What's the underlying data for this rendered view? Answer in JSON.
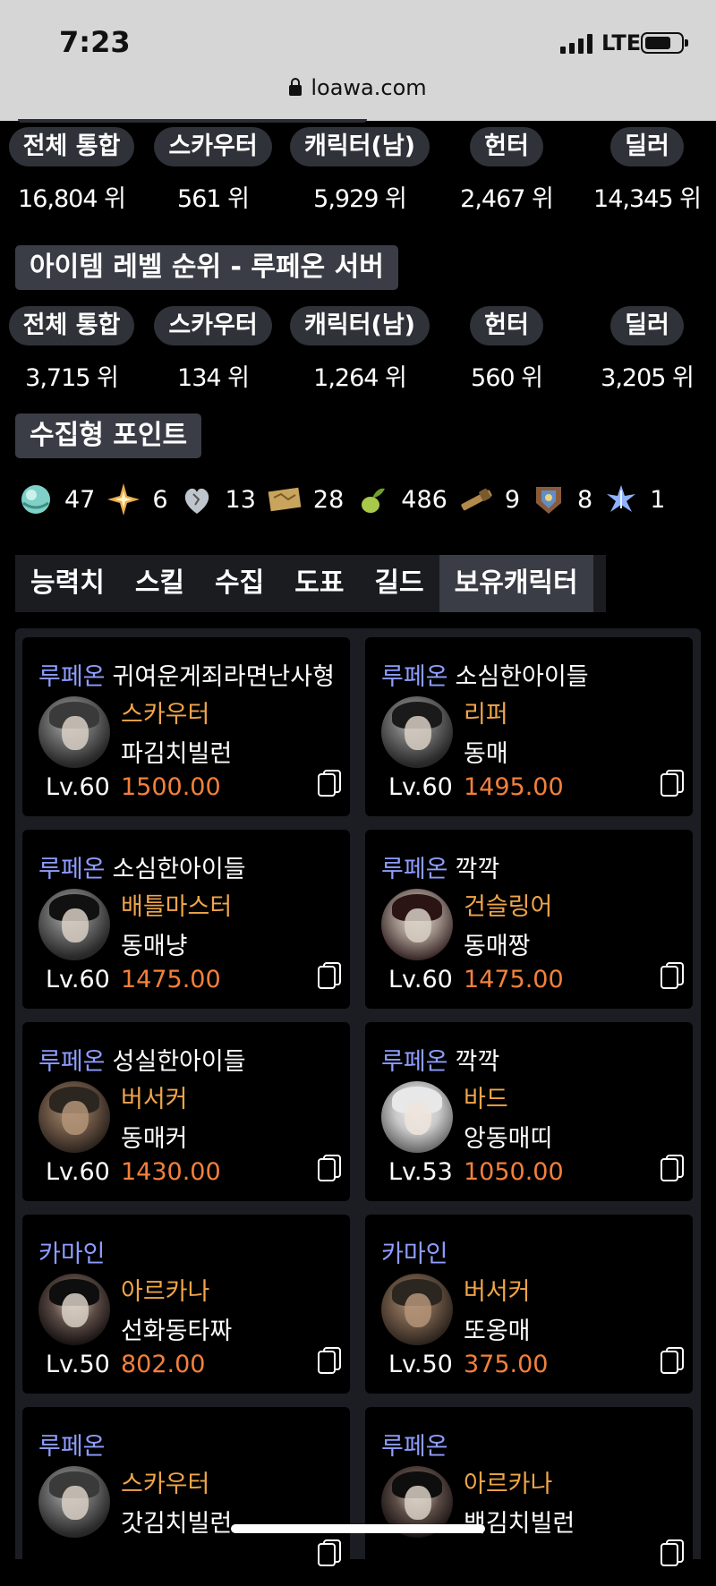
{
  "status_bar": {
    "time": "7:23",
    "network": "LTE"
  },
  "browser": {
    "url": "loawa.com"
  },
  "rankings": [
    {
      "cols": [
        {
          "label": "전체 통합",
          "value": "16,804 위"
        },
        {
          "label": "스카우터",
          "value": "561 위"
        },
        {
          "label": "캐릭터(남)",
          "value": "5,929 위"
        },
        {
          "label": "헌터",
          "value": "2,467 위"
        },
        {
          "label": "딜러",
          "value": "14,345 위"
        }
      ]
    },
    {
      "title": "아이템 레벨 순위 - 루페온 서버",
      "cols": [
        {
          "label": "전체 통합",
          "value": "3,715 위"
        },
        {
          "label": "스카우터",
          "value": "134 위"
        },
        {
          "label": "캐릭터(남)",
          "value": "1,264 위"
        },
        {
          "label": "헌터",
          "value": "560 위"
        },
        {
          "label": "딜러",
          "value": "3,205 위"
        }
      ]
    }
  ],
  "collection": {
    "title": "수집형 포인트",
    "items": [
      {
        "icon": "island-heart-icon",
        "count": "47"
      },
      {
        "icon": "star-seed-icon",
        "count": "6"
      },
      {
        "icon": "giant-heart-icon",
        "count": "13"
      },
      {
        "icon": "art-map-icon",
        "count": "28"
      },
      {
        "icon": "mokoko-seed-icon",
        "count": "486"
      },
      {
        "icon": "voyage-telescope-icon",
        "count": "9"
      },
      {
        "icon": "ignea-token-icon",
        "count": "8"
      },
      {
        "icon": "world-tree-leaf-icon",
        "count": "1"
      }
    ]
  },
  "tabs": [
    "능력치",
    "스킬",
    "수집",
    "도표",
    "길드",
    "보유캐릭터"
  ],
  "active_tab": "보유캐릭터",
  "characters": [
    {
      "server": "루페온",
      "guild": "귀여운게죄라면난사형",
      "class": "스카우터",
      "name": "파김치빌런",
      "level": "Lv.60",
      "item_level": "1500.00"
    },
    {
      "server": "루페온",
      "guild": "소심한아이들",
      "class": "리퍼",
      "name": "동매",
      "level": "Lv.60",
      "item_level": "1495.00"
    },
    {
      "server": "루페온",
      "guild": "소심한아이들",
      "class": "배틀마스터",
      "name": "동매냥",
      "level": "Lv.60",
      "item_level": "1475.00"
    },
    {
      "server": "루페온",
      "guild": "깍깍",
      "class": "건슬링어",
      "name": "동매짱",
      "level": "Lv.60",
      "item_level": "1475.00"
    },
    {
      "server": "루페온",
      "guild": "성실한아이들",
      "class": "버서커",
      "name": "동매커",
      "level": "Lv.60",
      "item_level": "1430.00"
    },
    {
      "server": "루페온",
      "guild": "깍깍",
      "class": "바드",
      "name": "앙동매띠",
      "level": "Lv.53",
      "item_level": "1050.00"
    },
    {
      "server": "카마인",
      "guild": "",
      "class": "아르카나",
      "name": "선화동타짜",
      "level": "Lv.50",
      "item_level": "802.00"
    },
    {
      "server": "카마인",
      "guild": "",
      "class": "버서커",
      "name": "또옹매",
      "level": "Lv.50",
      "item_level": "375.00"
    },
    {
      "server": "루페온",
      "guild": "",
      "class": "스카우터",
      "name": "갓김치빌런",
      "level": "",
      "item_level": ""
    },
    {
      "server": "루페온",
      "guild": "",
      "class": "아르카나",
      "name": "백김치빌런",
      "level": "",
      "item_level": ""
    }
  ]
}
